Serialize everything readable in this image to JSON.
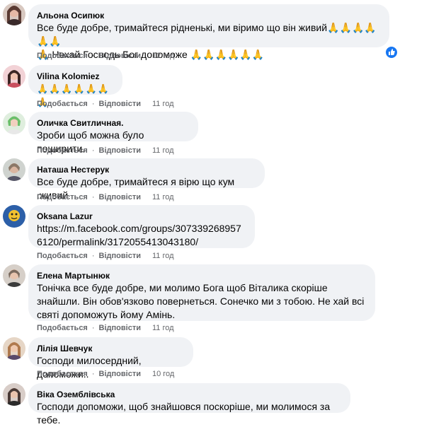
{
  "comments": [
    {
      "author": "Альона Осипюк",
      "lines": [
        "Все буде добре, тримайтеся рідненькі, ми віримо що він живий🙏🙏🙏🙏🙏🙏",
        "🙏 Нехай Господь Бог допоможе 🙏🙏🙏🙏🙏🙏"
      ],
      "like": "Подобається",
      "reply": "Відповісти",
      "time": "12 год",
      "avatar_color": "#5a3a32"
    },
    {
      "author": "Vilina Kolomiez",
      "lines": [
        "🙏🙏🙏🙏🙏🙏🙏"
      ],
      "like": "Подобається",
      "reply": "Відповісти",
      "time": "11 год",
      "avatar_color": "#c94f5e"
    },
    {
      "author": "Оличка Свитличная.",
      "lines": [
        "Зроби щоб можна було поширити."
      ],
      "like": "Подобається",
      "reply": "Відповісти",
      "time": "11 год",
      "avatar_color": "#6bbf6a"
    },
    {
      "author": "Наташа Нестерук",
      "lines": [
        "Все буде добре, тримайтеся я вірю що кум .живий"
      ],
      "like": "Подобається",
      "reply": "Відповісти",
      "time": "11 год",
      "avatar_color": "#8b7868"
    },
    {
      "author": "Oksana Lazur",
      "lines": [
        "https://m.facebook.com/groups/3073392689576120/permalink/3172055413043180/"
      ],
      "like": "Подобається",
      "reply": "Відповісти",
      "time": "11 год",
      "avatar_color": "#2c5fa8"
    },
    {
      "author": "Елена Мартынюк",
      "lines": [
        "Тонічка все буде добре, ми молимо Бога щоб Віталика скоріше знайшли. Він обов'язково повернеться. Сонечко ми з тобою. Не хай всі святі допоможуть йому Амінь."
      ],
      "like": "Подобається",
      "reply": "Відповісти",
      "time": "11 год",
      "avatar_color": "#7a6a5e"
    },
    {
      "author": "Лілія Шевчук",
      "lines": [
        "Господи милосердний, допоможи.."
      ],
      "like": "Подобається",
      "reply": "Відповісти",
      "time": "10 год",
      "avatar_color": "#b07a4e"
    },
    {
      "author": "Віка Оземблівська",
      "lines": [
        "Господи допоможи, щоб знайшовся поскоріше, ми молимося за тебе."
      ],
      "like": "",
      "reply": "",
      "time": "",
      "avatar_color": "#4a3a36"
    }
  ]
}
